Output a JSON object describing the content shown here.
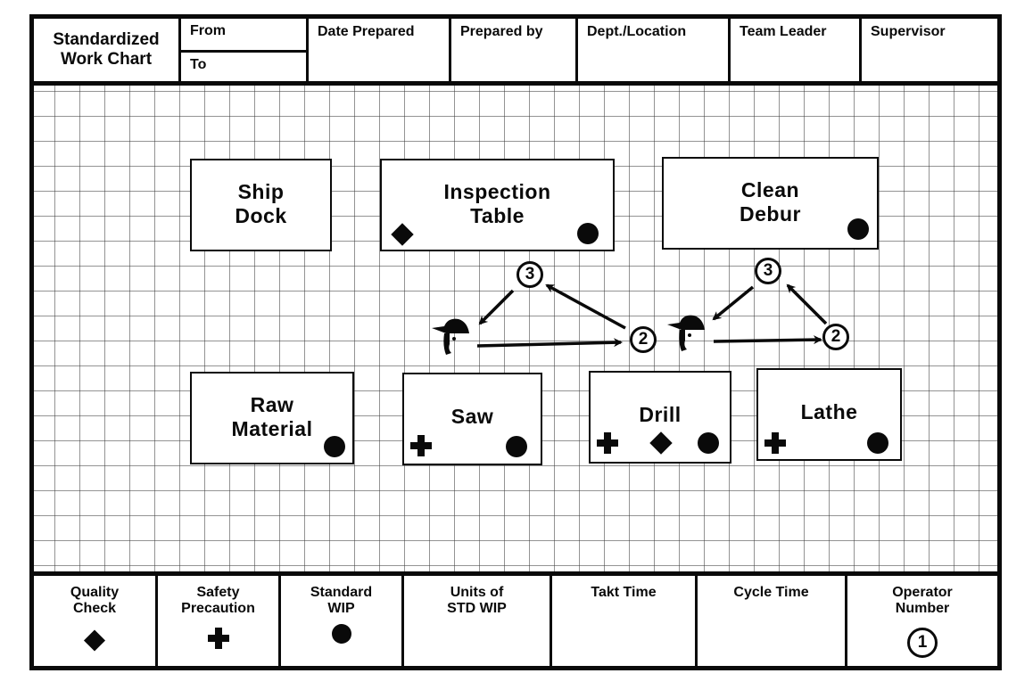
{
  "header": {
    "title_line1": "Standardized",
    "title_line2": "Work Chart",
    "from_label": "From",
    "to_label": "To",
    "date_prepared_label": "Date Prepared",
    "prepared_by_label": "Prepared by",
    "dept_location_label": "Dept./Location",
    "team_leader_label": "Team Leader",
    "supervisor_label": "Supervisor"
  },
  "stations": [
    {
      "id": "ship-dock",
      "line1": "Ship",
      "line2": "Dock",
      "symbols": []
    },
    {
      "id": "inspection-table",
      "line1": "Inspection",
      "line2": "Table",
      "symbols": [
        "quality-check",
        "standard-wip"
      ]
    },
    {
      "id": "clean-debur",
      "line1": "Clean",
      "line2": "Debur",
      "symbols": [
        "standard-wip"
      ]
    },
    {
      "id": "raw-material",
      "line1": "Raw",
      "line2": "Material",
      "symbols": [
        "standard-wip"
      ]
    },
    {
      "id": "saw",
      "line1": "Saw",
      "line2": "",
      "symbols": [
        "safety-precaution",
        "standard-wip"
      ]
    },
    {
      "id": "drill",
      "line1": "Drill",
      "line2": "",
      "symbols": [
        "safety-precaution",
        "quality-check",
        "standard-wip"
      ]
    },
    {
      "id": "lathe",
      "line1": "Lathe",
      "line2": "",
      "symbols": [
        "safety-precaution",
        "standard-wip"
      ]
    }
  ],
  "operator_steps": [
    {
      "group": "left",
      "label": "2"
    },
    {
      "group": "left",
      "label": "3"
    },
    {
      "group": "right",
      "label": "2"
    },
    {
      "group": "right",
      "label": "3"
    }
  ],
  "footer": {
    "quality_check_line1": "Quality",
    "quality_check_line2": "Check",
    "safety_line1": "Safety",
    "safety_line2": "Precaution",
    "std_wip_line1": "Standard",
    "std_wip_line2": "WIP",
    "units_line1": "Units of",
    "units_line2": "STD WIP",
    "takt_time": "Takt Time",
    "cycle_time": "Cycle Time",
    "operator_line1": "Operator",
    "operator_line2": "Number",
    "operator_number": "1"
  },
  "colors": {
    "ink": "#0a0a0a",
    "paper": "#ffffff",
    "grid": "#5a5a5a"
  }
}
